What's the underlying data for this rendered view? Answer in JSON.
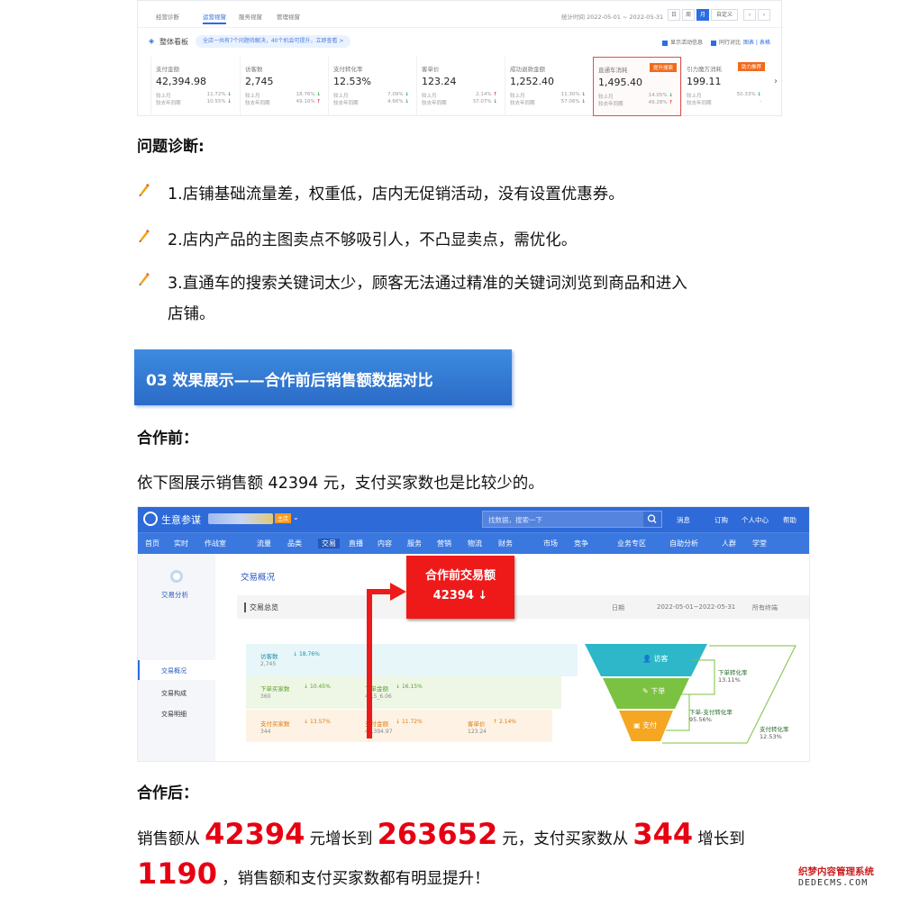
{
  "dashboard": {
    "tabs": [
      "经营诊断",
      "运营视窗",
      "服务视窗",
      "管理视窗"
    ],
    "date_range": "统计时间 2022-05-01 ~ 2022-05-31",
    "periods": [
      "日",
      "周",
      "月",
      "自定义"
    ],
    "section_title": "整体看板",
    "notice": "全店一共有7个问题待解决，40个机会可提升，立即查看 >",
    "options": [
      "显示活动信息",
      "同行对比",
      "图表 | 表格"
    ],
    "metrics": [
      {
        "name": "支付金额",
        "value": "42,394.98",
        "r1": "较上月",
        "p1": "11.72%",
        "d1": "down",
        "r2": "较去年同期",
        "p2": "10.55%",
        "d2": "down"
      },
      {
        "name": "访客数",
        "value": "2,745",
        "r1": "较上月",
        "p1": "18.76%",
        "d1": "down",
        "r2": "较去年同期",
        "p2": "49.10%",
        "d2": "up"
      },
      {
        "name": "支付转化率",
        "value": "12.53%",
        "r1": "较上月",
        "p1": "7.09%",
        "d1": "down",
        "r2": "较去年同期",
        "p2": "4.66%",
        "d2": "down"
      },
      {
        "name": "客单价",
        "value": "123.24",
        "r1": "较上月",
        "p1": "2.14%",
        "d1": "up",
        "r2": "较去年同期",
        "p2": "37.07%",
        "d2": "down"
      },
      {
        "name": "成功退款金额",
        "value": "1,252.40",
        "r1": "较上月",
        "p1": "11.30%",
        "d1": "down",
        "r2": "较去年同期",
        "p2": "57.06%",
        "d2": "down"
      },
      {
        "name": "直通车消耗",
        "value": "1,495.40",
        "badge": "提升搜索",
        "r1": "较上月",
        "p1": "14.05%",
        "d1": "down",
        "r2": "较去年同期",
        "p2": "49.28%",
        "d2": "up"
      },
      {
        "name": "引力魔方消耗",
        "value": "199.11",
        "badge": "助力推荐",
        "r1": "较上月",
        "p1": "50.33%",
        "d1": "down",
        "r2": "较去年同期",
        "p2": "-",
        "d2": ""
      }
    ]
  },
  "diagnosis": {
    "title": "问题诊断:",
    "items": [
      "1.店铺基础流量差，权重低，店内无促销活动，没有设置优惠券。",
      "2.店内产品的主图卖点不够吸引人，不凸显卖点，需优化。",
      "3.直通车的搜索关键词太少，顾客无法通过精准的关键词浏览到商品和进入",
      "店铺。"
    ]
  },
  "section_banner": "03 效果展示——合作前后销售额数据对比",
  "before": {
    "title": "合作前：",
    "desc": "依下图展示销售额 42394 元，支付买家数也是比较少的。"
  },
  "shot": {
    "brand": "生意参谋",
    "shop_tag": "主店",
    "search_placeholder": "找数据，搜索一下",
    "top_links": [
      "消息",
      "订购",
      "个人中心",
      "帮助"
    ],
    "nav": [
      "首页",
      "实时",
      "作战室",
      "流量",
      "品类",
      "交易",
      "直播",
      "内容",
      "服务",
      "营销",
      "物流",
      "财务",
      "市场",
      "竞争",
      "业务专区",
      "自助分析",
      "人群",
      "学堂"
    ],
    "side_title": "交易分析",
    "side_items": [
      "交易概况",
      "交易构成",
      "交易明细"
    ],
    "page_title": "交易概况",
    "overview": "交易总览",
    "date_label": "日期",
    "date_value": "2022-05-01~2022-05-31",
    "terminal": "所有终端",
    "funnel_rows": [
      {
        "label": "访客数",
        "pct": "18.76%",
        "value": "2,745"
      },
      {
        "label": "下单买家数",
        "pct": "10.45%",
        "value": "360",
        "label2": "下单金额",
        "pct2": "16.15%",
        "value2": "43,5_6.06"
      },
      {
        "label": "支付买家数",
        "pct": "13.57%",
        "value": "344",
        "label2": "支付金额",
        "pct2": "11.72%",
        "value2": "42,394.97",
        "label3": "客单价",
        "pct3": "2.14%",
        "value3": "123.24"
      }
    ],
    "funnel": {
      "stages": [
        "访客",
        "下单",
        "支付"
      ],
      "rate1_label": "下单转化率",
      "rate1": "13.11%",
      "rate2_label": "下单-支付转化率",
      "rate2": "95.56%",
      "rate3_label": "支付转化率",
      "rate3": "12.53%"
    },
    "callout_title": "合作前交易额",
    "callout_value": "42394 ↓"
  },
  "after": {
    "title": "合作后：",
    "p1": "销售额从",
    "n1": "42394",
    "p2": "元增长到",
    "n2": "263652",
    "p3": "元，支付买家数从",
    "n3": "344",
    "p4": "增长到",
    "n4": "1190",
    "p5": "，销售额和支付买家数都有明显提升！"
  },
  "watermark": {
    "line1": "织梦内容管理系统",
    "line2": "DEDECMS.COM"
  }
}
